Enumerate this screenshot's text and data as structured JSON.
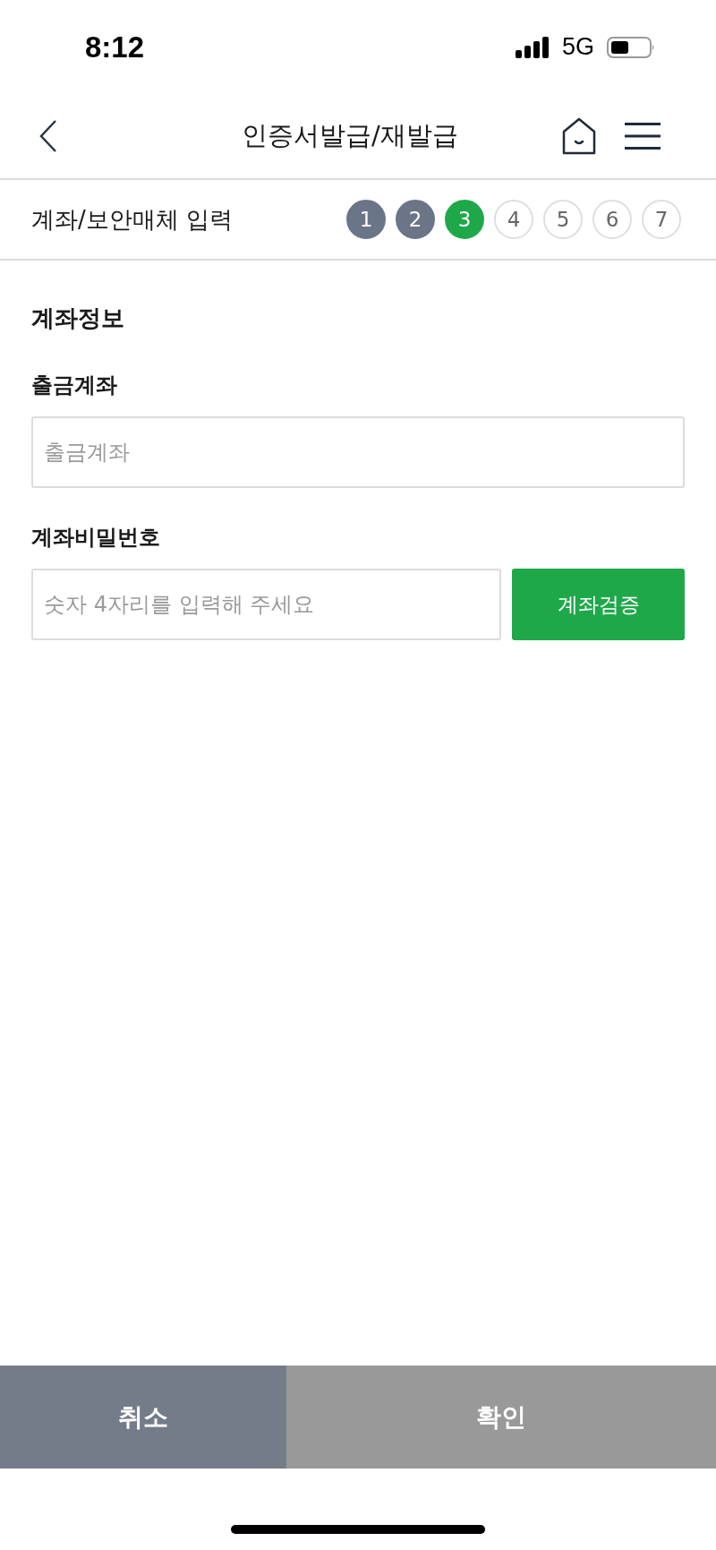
{
  "status_bar": {
    "time": "8:12",
    "network": "5G"
  },
  "header": {
    "title": "인증서발급/재발급"
  },
  "steps": {
    "label": "계좌/보안매체 입력",
    "items": [
      {
        "number": "1",
        "done": true,
        "current": false
      },
      {
        "number": "2",
        "done": true,
        "current": false
      },
      {
        "number": "3",
        "done": false,
        "current": true
      },
      {
        "number": "4",
        "done": false,
        "current": false
      },
      {
        "number": "5",
        "done": false,
        "current": false
      },
      {
        "number": "6",
        "done": false,
        "current": false
      },
      {
        "number": "7",
        "done": false,
        "current": false
      }
    ]
  },
  "form": {
    "section_title": "계좌정보",
    "fields": [
      {
        "label": "출금계좌",
        "placeholder": "출금계좌"
      },
      {
        "label": "계좌비밀번호",
        "placeholder": "숫자 4자리를 입력해 주세요",
        "button": "계좌검증"
      }
    ]
  },
  "footer_buttons": [
    {
      "label": "취소",
      "kind": "cancel",
      "disabled": false
    },
    {
      "label": "확인",
      "kind": "confirm",
      "disabled": true
    }
  ]
}
